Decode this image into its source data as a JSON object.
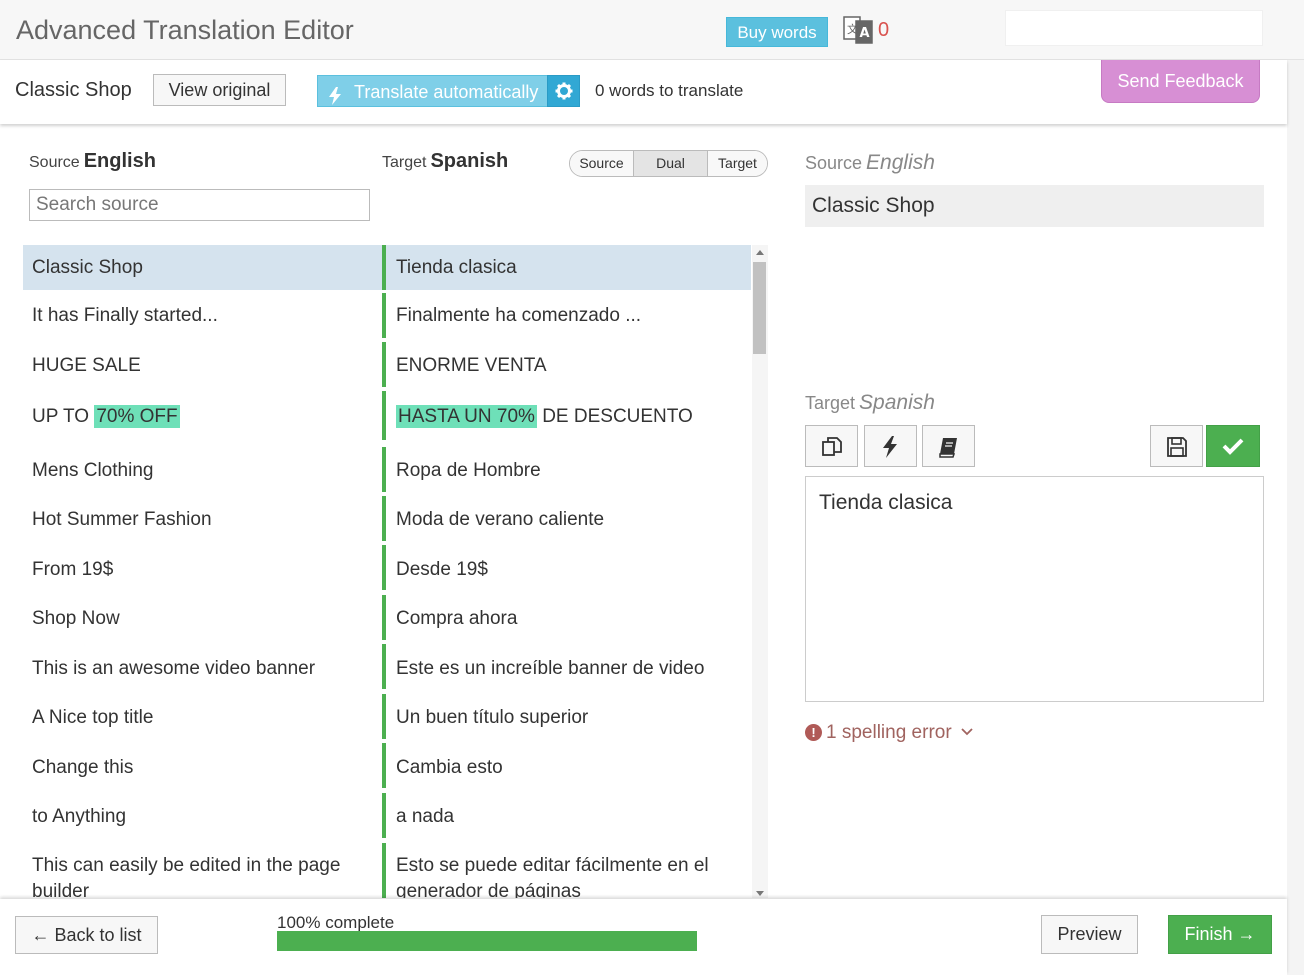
{
  "app": {
    "title": "Advanced Translation Editor",
    "buy_label": "Buy words",
    "credit_count": "0"
  },
  "toolbar": {
    "doc_name": "Classic Shop",
    "view_original_label": "View original",
    "translate_auto_label": "Translate automatically",
    "words_to_translate": "0 words to translate",
    "feedback_label": "Send Feedback"
  },
  "list_header": {
    "source_label": "Source",
    "source_lang": "English",
    "target_label": "Target",
    "target_lang": "Spanish",
    "search_placeholder": "Search source",
    "view_modes": [
      "Source",
      "Dual",
      "Target"
    ],
    "active_view_mode": "Dual"
  },
  "rows": [
    {
      "source": "Classic Shop",
      "target": "Tienda clasica",
      "selected": true
    },
    {
      "source": "It has Finally started...",
      "target": "Finalmente ha comenzado ..."
    },
    {
      "source": "HUGE SALE",
      "target": "ENORME VENTA"
    },
    {
      "source_parts": [
        "UP TO ",
        "70% OFF",
        ""
      ],
      "target_parts": [
        "",
        "HASTA UN 70%",
        " DE DESCUENTO"
      ]
    },
    {
      "source": "Mens Clothing",
      "target": "Ropa de Hombre"
    },
    {
      "source": "Hot Summer Fashion",
      "target": "Moda de verano caliente"
    },
    {
      "source": "From 19$",
      "target": "Desde 19$"
    },
    {
      "source": "Shop Now",
      "target": "Compra ahora"
    },
    {
      "source": "This is an awesome video banner",
      "target": "Este es un increíble banner de video"
    },
    {
      "source": "A Nice top title",
      "target": "Un buen título superior"
    },
    {
      "source": "Change this",
      "target": "Cambia esto"
    },
    {
      "source": "to Anything",
      "target": "a nada"
    },
    {
      "source": "This can easily be edited in the page builder",
      "target": "Esto se puede editar fácilmente en el generador de páginas"
    }
  ],
  "editor": {
    "source_label": "Source",
    "source_lang": "English",
    "source_text": "Classic Shop",
    "target_label": "Target",
    "target_lang": "Spanish",
    "target_text": "Tienda clasica",
    "spelling": "1 spelling error"
  },
  "footer": {
    "back_label": "← Back to list",
    "progress_label": "100% complete",
    "progress_percent": 100,
    "preview_label": "Preview",
    "finish_label": "Finish →"
  },
  "colors": {
    "accent_blue": "#5bc0de",
    "success_green": "#4caf50",
    "feedback_purple": "#d78fd4",
    "highlight": "#6ee0b8",
    "error_red": "#d9534f"
  },
  "icons": {
    "translate": "translate-icon",
    "bolt": "bolt-icon",
    "gear": "gear-icon",
    "copy": "copy-icon",
    "dictionary": "book-icon",
    "save": "save-icon",
    "check": "check-icon",
    "warning": "exclamation-icon",
    "chevron": "chevron-down-icon"
  }
}
